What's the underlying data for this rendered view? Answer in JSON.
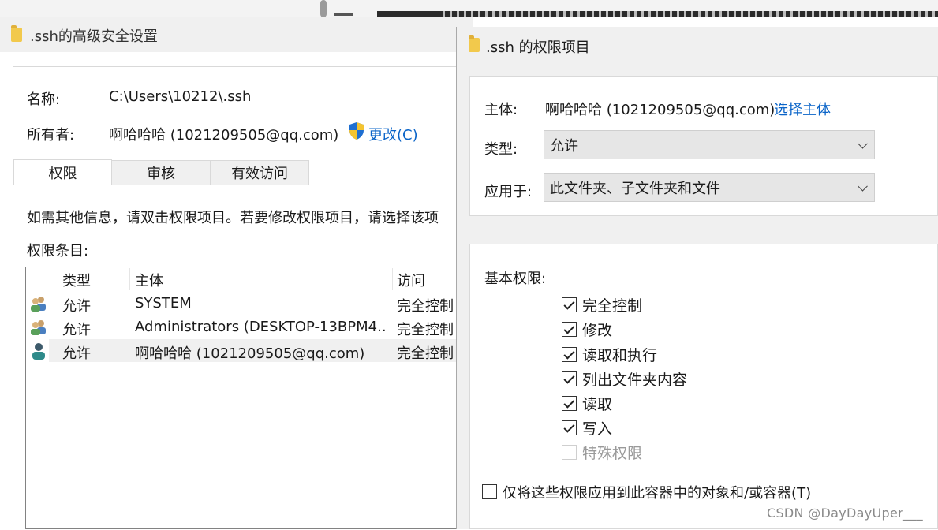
{
  "back_window": {
    "title": ".ssh的高级安全设置",
    "name_label": "名称:",
    "name_value": "C:\\Users\\10212\\.ssh",
    "owner_label": "所有者:",
    "owner_value": "啊哈哈哈 (1021209505@qq.com)",
    "change_link": "更改(C)",
    "tabs": [
      {
        "label": "权限",
        "active": true
      },
      {
        "label": "审核",
        "active": false
      },
      {
        "label": "有效访问",
        "active": false
      }
    ],
    "info_text": "如需其他信息，请双击权限项目。若要修改权限项目，请选择该项",
    "entries_label": "权限条目:",
    "columns": [
      "类型",
      "主体",
      "访问"
    ],
    "rows": [
      {
        "type": "允许",
        "principal": "SYSTEM",
        "access": "完全控制",
        "icon": "user-group-icon"
      },
      {
        "type": "允许",
        "principal": "Administrators (DESKTOP-13BPM4...",
        "access": "完全控制",
        "icon": "user-group-icon"
      },
      {
        "type": "允许",
        "principal": "啊哈哈哈 (1021209505@qq.com)",
        "access": "完全控制",
        "icon": "user-icon"
      }
    ]
  },
  "front_window": {
    "title": ".ssh 的权限项目",
    "principal_label": "主体:",
    "principal_value": "啊哈哈哈 (1021209505@qq.com)",
    "select_principal_link": "选择主体",
    "type_label": "类型:",
    "type_value": "允许",
    "applies_label": "应用于:",
    "applies_value": "此文件夹、子文件夹和文件",
    "basic_permissions_label": "基本权限:",
    "permissions": [
      {
        "label": "完全控制",
        "checked": true,
        "enabled": true
      },
      {
        "label": "修改",
        "checked": true,
        "enabled": true
      },
      {
        "label": "读取和执行",
        "checked": true,
        "enabled": true
      },
      {
        "label": "列出文件夹内容",
        "checked": true,
        "enabled": true
      },
      {
        "label": "读取",
        "checked": true,
        "enabled": true
      },
      {
        "label": "写入",
        "checked": true,
        "enabled": true
      },
      {
        "label": "特殊权限",
        "checked": false,
        "enabled": false
      }
    ],
    "apply_only_label": "仅将这些权限应用到此容器中的对象和/或容器(T)",
    "apply_only_checked": false
  },
  "watermark": "CSDN @DayDayUper___",
  "colors": {
    "link": "#0a64c8",
    "folder": "#f2c94c",
    "selected_row": "#f0f0f0"
  }
}
